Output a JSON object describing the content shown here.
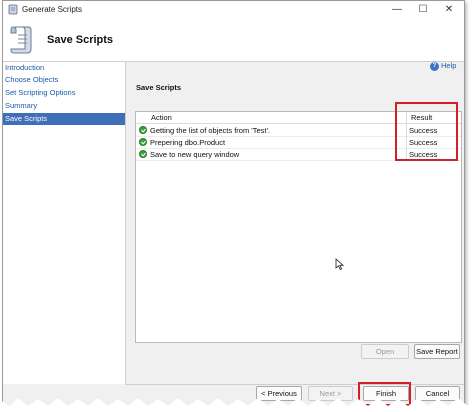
{
  "window": {
    "title": "Generate Scripts",
    "min": "—",
    "max": "☐",
    "close": "✕"
  },
  "header": {
    "title": "Save Scripts"
  },
  "sidebar": {
    "items": [
      {
        "label": "Introduction",
        "active": false
      },
      {
        "label": "Choose Objects",
        "active": false
      },
      {
        "label": "Set Scripting Options",
        "active": false
      },
      {
        "label": "Summary",
        "active": false
      },
      {
        "label": "Save Scripts",
        "active": true
      }
    ]
  },
  "help": {
    "label": "Help"
  },
  "main": {
    "section_title": "Save Scripts",
    "columns": {
      "action": "Action",
      "result": "Result"
    },
    "rows": [
      {
        "action": "Getting the list of objects from 'Test'.",
        "result": "Success"
      },
      {
        "action": "Prepering dbo.Product",
        "result": "Success"
      },
      {
        "action": "Save to new query window",
        "result": "Success"
      }
    ]
  },
  "buttons": {
    "open": "Open",
    "save_report": "Save Report",
    "previous": "< Previous",
    "next": "Next >",
    "finish": "Finish",
    "cancel": "Cancel"
  },
  "colors": {
    "highlight": "#d0202a",
    "success": "#3aa33a",
    "nav_active": "#3f6fb8",
    "link": "#1a5aa8"
  }
}
